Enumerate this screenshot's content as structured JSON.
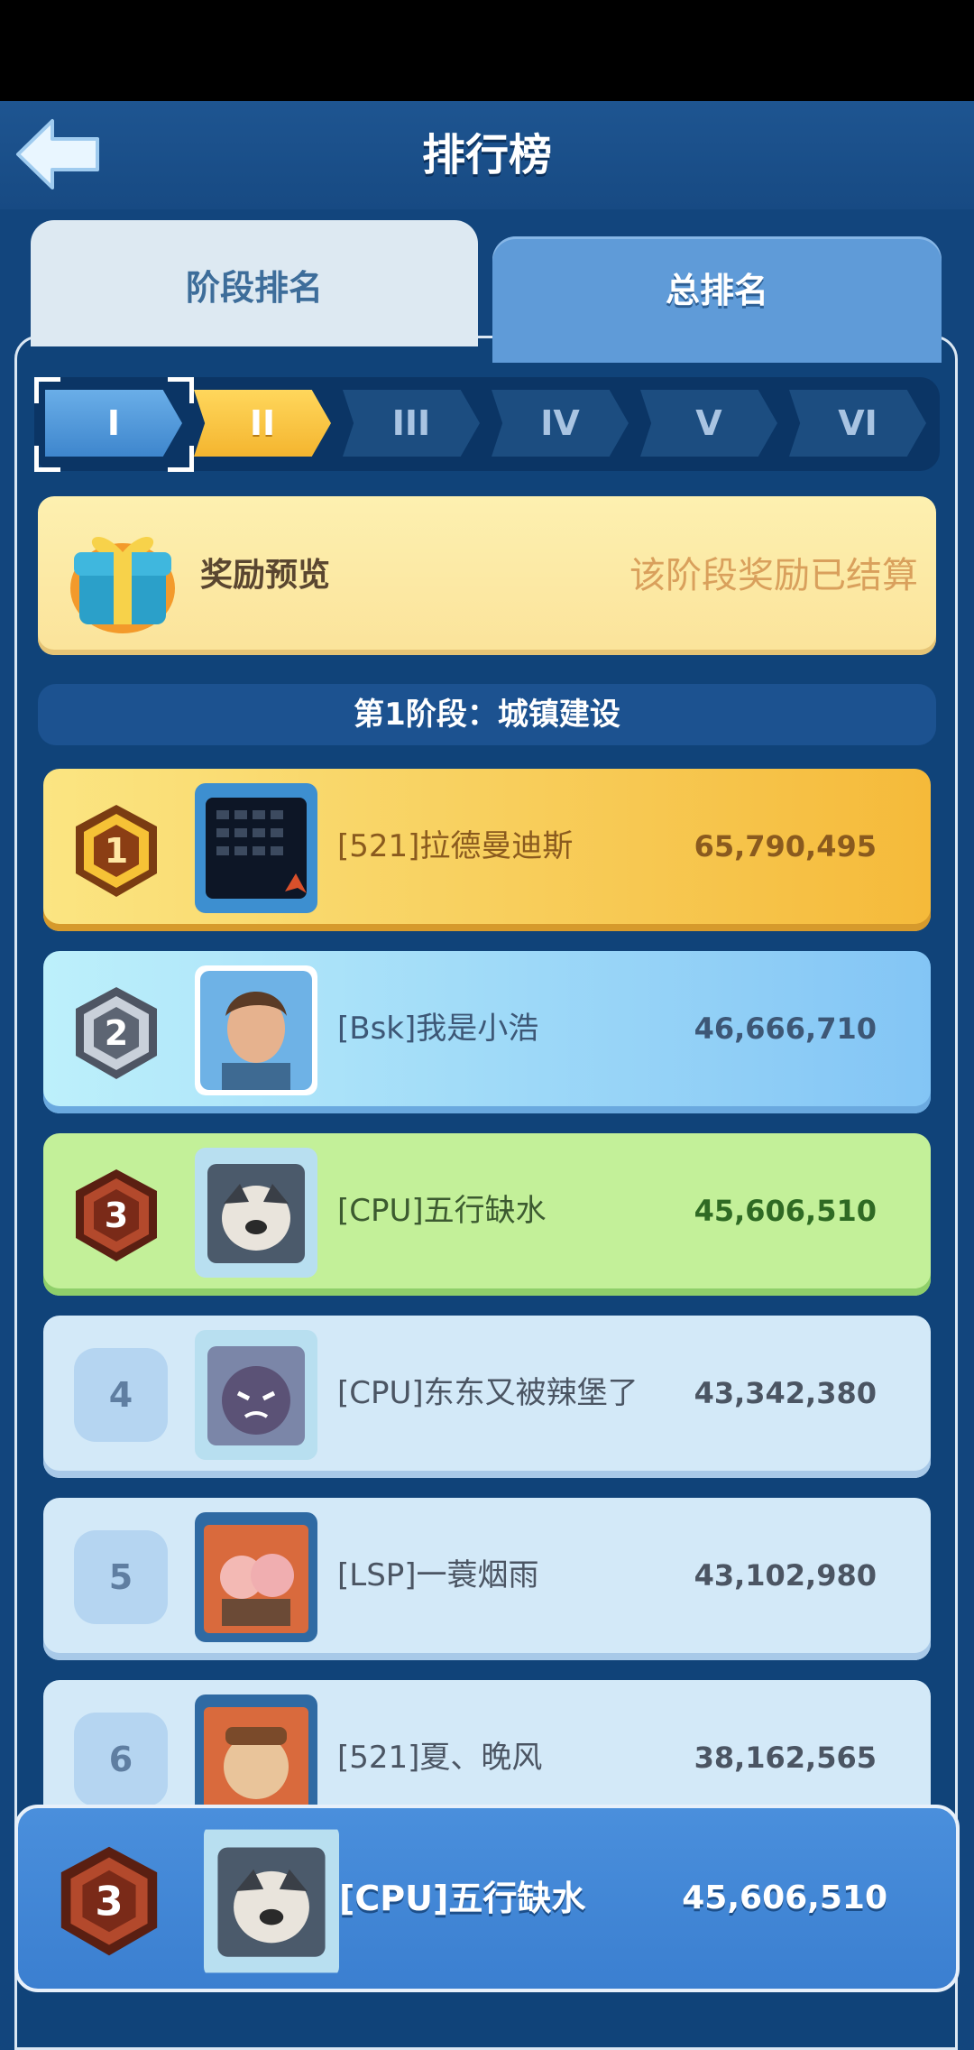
{
  "header": {
    "title": "排行榜"
  },
  "tabs": [
    {
      "label": "阶段排名",
      "active": true
    },
    {
      "label": "总排名",
      "active": false
    }
  ],
  "stages": [
    "I",
    "II",
    "III",
    "IV",
    "V",
    "VI"
  ],
  "stage_selected": "I",
  "stage_current": "II",
  "reward": {
    "title": "奖励预览",
    "status": "该阶段奖励已结算"
  },
  "phase_title": "第1阶段：城镇建设",
  "rows": [
    {
      "rank": "1",
      "name": "[521]拉德曼迪斯",
      "score": "65,790,495"
    },
    {
      "rank": "2",
      "name": "[Bsk]我是小浩",
      "score": "46,666,710"
    },
    {
      "rank": "3",
      "name": "[CPU]五行缺水",
      "score": "45,606,510"
    },
    {
      "rank": "4",
      "name": "[CPU]东东又被辣堡了",
      "score": "43,342,380"
    },
    {
      "rank": "5",
      "name": "[LSP]一蓑烟雨",
      "score": "43,102,980"
    },
    {
      "rank": "6",
      "name": "[521]夏、晚风",
      "score": "38,162,565"
    }
  ],
  "my_rank": {
    "rank": "3",
    "name": "[CPU]五行缺水",
    "score": "45,606,510"
  },
  "colors": {
    "gold": "#f5ba3a",
    "silver": "#83c5f5",
    "bronze": "#c3f099",
    "accent": "#3b7fd0"
  }
}
